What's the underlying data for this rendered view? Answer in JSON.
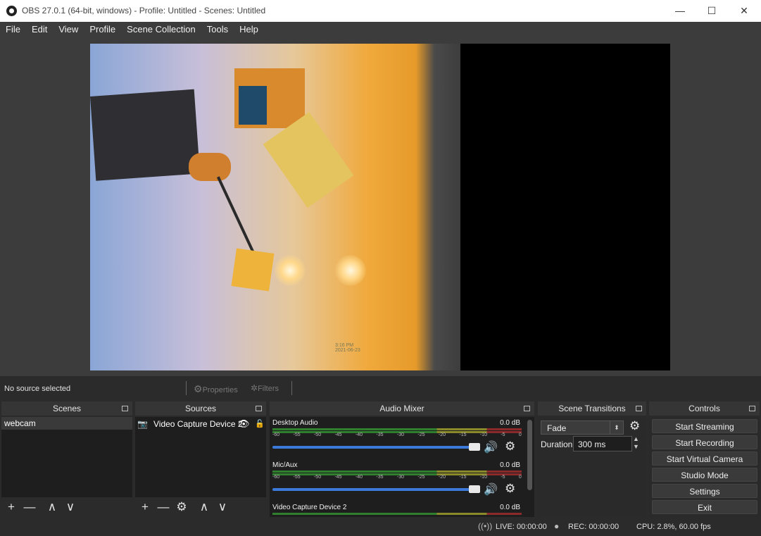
{
  "window": {
    "title": "OBS 27.0.1 (64-bit, windows) - Profile: Untitled - Scenes: Untitled",
    "minimize_glyph": "—",
    "maximize_glyph": "☐",
    "close_glyph": "✕"
  },
  "menu": [
    "File",
    "Edit",
    "View",
    "Profile",
    "Scene Collection",
    "Tools",
    "Help"
  ],
  "preview": {
    "timestamp": "3:16 PM",
    "date": "2021-06-23"
  },
  "source_bar": {
    "status": "No source selected",
    "properties_label": "Properties",
    "filters_label": "Filters"
  },
  "scenes": {
    "header": "Scenes",
    "items": [
      "webcam"
    ]
  },
  "sources": {
    "header": "Sources",
    "items": [
      {
        "name": "Video Capture Device 2",
        "visible": true,
        "locked": false
      }
    ]
  },
  "mixer": {
    "header": "Audio Mixer",
    "ticks": [
      "-60",
      "-55",
      "-50",
      "-45",
      "-40",
      "-35",
      "-30",
      "-25",
      "-20",
      "-15",
      "-10",
      "-5",
      "0"
    ],
    "channels": [
      {
        "name": "Desktop Audio",
        "db": "0.0 dB",
        "volume": 1.0
      },
      {
        "name": "Mic/Aux",
        "db": "0.0 dB",
        "volume": 1.0
      },
      {
        "name": "Video Capture Device 2",
        "db": "0.0 dB",
        "volume": 1.0
      }
    ]
  },
  "transitions": {
    "header": "Scene Transitions",
    "selected": "Fade",
    "duration_label": "Duration",
    "duration_value": "300 ms"
  },
  "controls": {
    "header": "Controls",
    "buttons": [
      "Start Streaming",
      "Start Recording",
      "Start Virtual Camera",
      "Studio Mode",
      "Settings",
      "Exit"
    ]
  },
  "status": {
    "live": "LIVE: 00:00:00",
    "rec": "REC: 00:00:00",
    "cpu": "CPU: 2.8%, 60.00 fps"
  },
  "icons": {
    "add": "+",
    "remove": "—",
    "up": "∧",
    "down": "∨",
    "gear": "⚙",
    "speaker": "🔊",
    "eye": "👁",
    "lock": "🔓",
    "camera": "📷"
  }
}
